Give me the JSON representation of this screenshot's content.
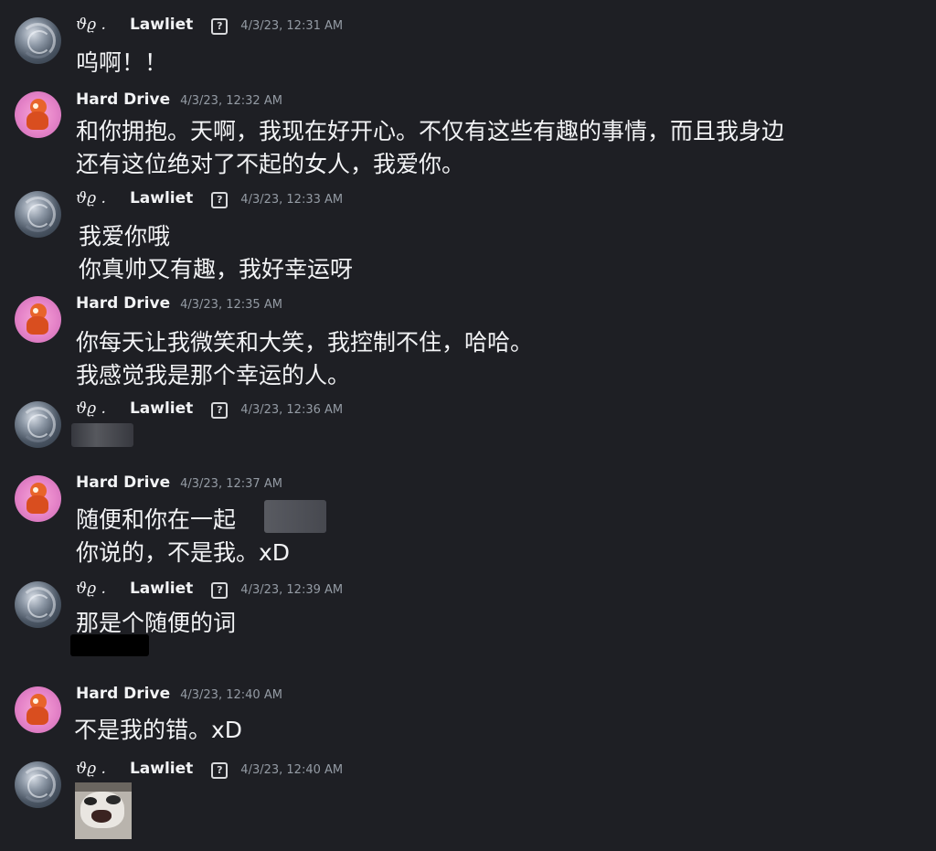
{
  "messages": [
    {
      "author": "Lawliet",
      "glyph": "ϑϱ .",
      "tag_icon": "question-square-icon",
      "timestamp": "4/3/23, 12:31 AM",
      "lines": [
        "呜啊！！"
      ]
    },
    {
      "author": "Hard Drive",
      "timestamp": "4/3/23, 12:32 AM",
      "lines": [
        "和你拥抱。天啊，我现在好开心。不仅有这些有趣的事情，而且我身边",
        "还有这位绝对了不起的女人，我爱你。"
      ]
    },
    {
      "author": "Lawliet",
      "glyph": "ϑϱ .",
      "tag_icon": "question-square-icon",
      "timestamp": "4/3/23, 12:33 AM",
      "lines": [
        "我爱你哦",
        "你真帅又有趣，我好幸运呀"
      ]
    },
    {
      "author": "Hard Drive",
      "timestamp": "4/3/23, 12:35 AM",
      "lines": [
        "你每天让我微笑和大笑，我控制不住，哈哈。",
        "我感觉我是那个幸运的人。"
      ]
    },
    {
      "author": "Lawliet",
      "glyph": "ϑϱ .",
      "tag_icon": "question-square-icon",
      "timestamp": "4/3/23, 12:36 AM",
      "lines": []
    },
    {
      "author": "Hard Drive",
      "timestamp": "4/3/23, 12:37 AM",
      "lines": [
        "随便和你在一起",
        "你说的，不是我。xD"
      ]
    },
    {
      "author": "Lawliet",
      "glyph": "ϑϱ .",
      "tag_icon": "question-square-icon",
      "timestamp": "4/3/23, 12:39 AM",
      "lines": [
        "那是个随便的词"
      ]
    },
    {
      "author": "Hard Drive",
      "timestamp": "4/3/23, 12:40 AM",
      "lines": [
        "不是我的错。xD"
      ]
    },
    {
      "author": "Lawliet",
      "glyph": "ϑϱ .",
      "tag_icon": "question-square-icon",
      "timestamp": "4/3/23, 12:40 AM",
      "lines": [],
      "attachment": "cat-sticker-image"
    }
  ],
  "colors": {
    "background": "#1e1f24",
    "text": "#f2f3f5",
    "timestamp": "#949ba4"
  }
}
